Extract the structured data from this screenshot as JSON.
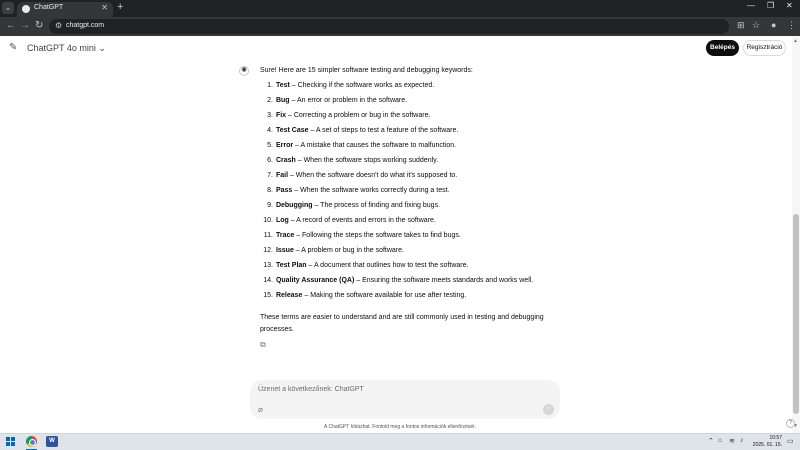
{
  "browser": {
    "tab_title": "ChatGPT",
    "tab_close": "✕",
    "new_tab": "+",
    "url": "chatgpt.com",
    "nav_back": "←",
    "nav_forward": "→",
    "nav_reload": "↻"
  },
  "header": {
    "model_name": "ChatGPT 4o mini ⌄",
    "login_label": "Belépés",
    "register_label": "Regisztráció"
  },
  "message": {
    "intro": "Sure! Here are 15 simpler software testing and debugging keywords:",
    "items": [
      {
        "num": "1.",
        "term": "Test",
        "def": " – Checking if the software works as expected."
      },
      {
        "num": "2.",
        "term": "Bug",
        "def": " – An error or problem in the software."
      },
      {
        "num": "3.",
        "term": "Fix",
        "def": " – Correcting a problem or bug in the software."
      },
      {
        "num": "4.",
        "term": "Test Case",
        "def": " – A set of steps to test a feature of the software."
      },
      {
        "num": "5.",
        "term": "Error",
        "def": " – A mistake that causes the software to malfunction."
      },
      {
        "num": "6.",
        "term": "Crash",
        "def": " – When the software stops working suddenly."
      },
      {
        "num": "7.",
        "term": "Fail",
        "def": " – When the software doesn't do what it's supposed to."
      },
      {
        "num": "8.",
        "term": "Pass",
        "def": " – When the software works correctly during a test."
      },
      {
        "num": "9.",
        "term": "Debugging",
        "def": " – The process of finding and fixing bugs."
      },
      {
        "num": "10.",
        "term": "Log",
        "def": " – A record of events and errors in the software."
      },
      {
        "num": "11.",
        "term": "Trace",
        "def": " – Following the steps the software takes to find bugs."
      },
      {
        "num": "12.",
        "term": "Issue",
        "def": " – A problem or bug in the software."
      },
      {
        "num": "13.",
        "term": "Test Plan",
        "def": " – A document that outlines how to test the software."
      },
      {
        "num": "14.",
        "term": "Quality Assurance (QA)",
        "def": " – Ensuring the software meets standards and works well."
      },
      {
        "num": "15.",
        "term": "Release",
        "def": " – Making the software available for use after testing."
      }
    ],
    "outro": "These terms are easier to understand and are still commonly used in testing and debugging processes."
  },
  "composer": {
    "placeholder": "Üzenet a következőnek: ChatGPT",
    "disclaimer": "A ChatGPT hibázhat. Fontold meg a fontos információk ellenőrzését.",
    "help": "?",
    "send": "↑"
  },
  "taskbar": {
    "app_label": "W",
    "time": "10:57",
    "date": "2025. 01. 15."
  },
  "icons": {
    "menu": "chevron-down-icon",
    "edit": "edit-icon",
    "copy": "copy-icon",
    "attach": "paperclip-icon"
  }
}
